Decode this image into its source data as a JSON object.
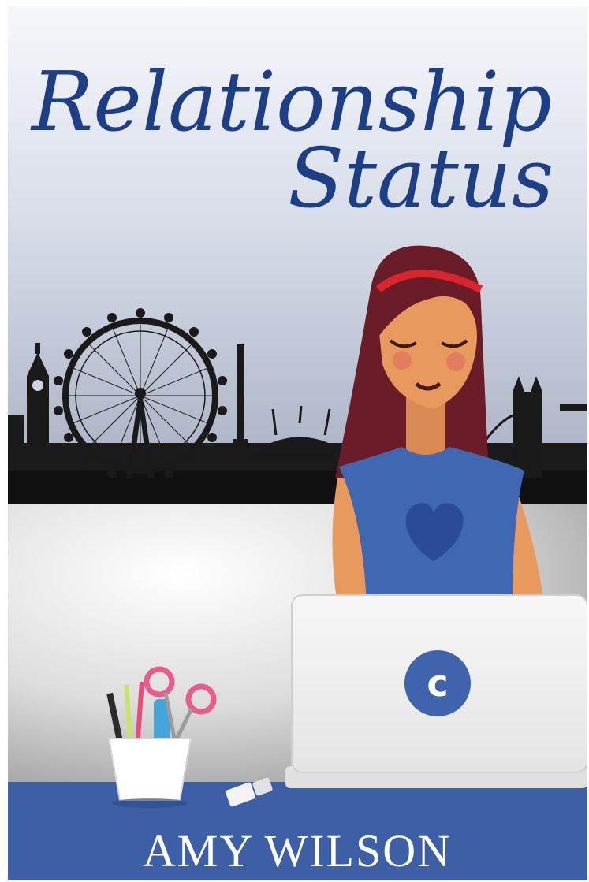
{
  "cover": {
    "title_line1": "Relationship",
    "title_line2": "Status",
    "author": "AMY WILSON",
    "laptop_logo_letter": "c"
  },
  "icons": {
    "ferris_wheel": "london-eye-icon",
    "clock_tower": "big-ben-icon",
    "bridge": "tower-bridge-icon",
    "dome": "o2-dome-icon",
    "laptop": "laptop-icon",
    "pen_cup": "pen-cup-icon",
    "sharpener": "sharpener-icon",
    "heart": "heart-icon"
  },
  "colors": {
    "title_blue": "#1c3f86",
    "desk_blue": "#3c5fa5",
    "shirt_blue": "#4067b1",
    "heart_blue": "#2a4c98",
    "skyline": "#1a1a1a",
    "hair": "#6a1d28",
    "headband": "#d8262c",
    "skin": "#e8995d",
    "laptop": "#f2f2f2",
    "logo_circle": "#3f63ad"
  }
}
